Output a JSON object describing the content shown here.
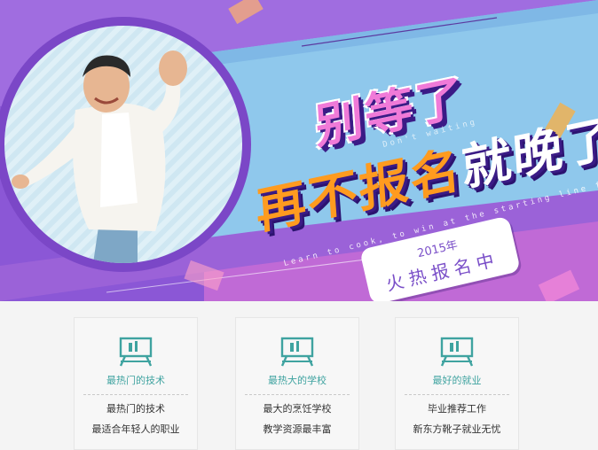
{
  "banner": {
    "headline_1": "别等了",
    "headline_2_orange": "再不报名",
    "headline_2_white": "就晚了",
    "script_1": "Don't waiting",
    "script_2": "Learn to cook, to win at the starting line from the peak of life",
    "tag_year": "2015年",
    "tag_text": "火热报名中"
  },
  "features": [
    {
      "title": "最热门的技术",
      "line1": "最热门的技术",
      "line2": "最适合年轻人的职业"
    },
    {
      "title": "最热大的学校",
      "line1": "最大的烹饪学校",
      "line2": "教学资源最丰富"
    },
    {
      "title": "最好的就业",
      "line1": "毕业推荐工作",
      "line2": "新东方靴子就业无忧"
    }
  ],
  "colors": {
    "accent": "#3fa3a0",
    "purple": "#8b57d6",
    "orange": "#ff9b1f",
    "pink": "#f07ad8"
  },
  "icons": {
    "feature_icon": "monitor-easel-icon"
  }
}
